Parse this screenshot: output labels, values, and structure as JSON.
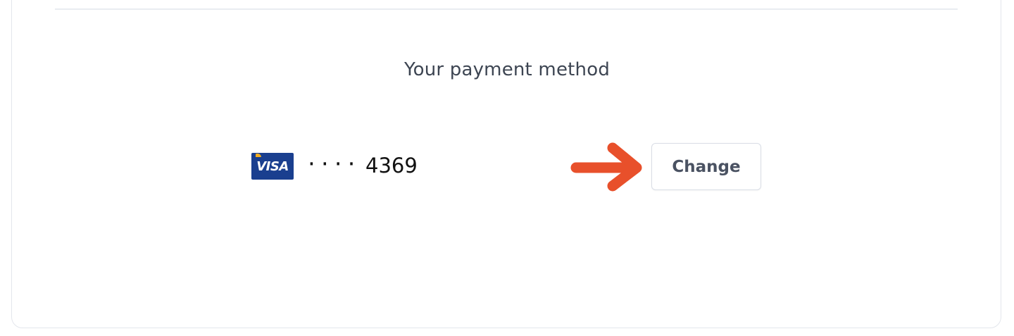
{
  "payment": {
    "title": "Your payment method",
    "card_brand": "VISA",
    "card_mask": "····",
    "card_last4": "4369",
    "change_label": "Change"
  },
  "colors": {
    "visa_blue": "#1a3f8f",
    "visa_gold": "#f2ad1f",
    "arrow": "#e8502b",
    "title_text": "#3d4552",
    "button_text": "#4a5262"
  },
  "icons": {
    "card_brand_icon": "visa-logo-icon",
    "pointer": "arrow-right-icon"
  }
}
